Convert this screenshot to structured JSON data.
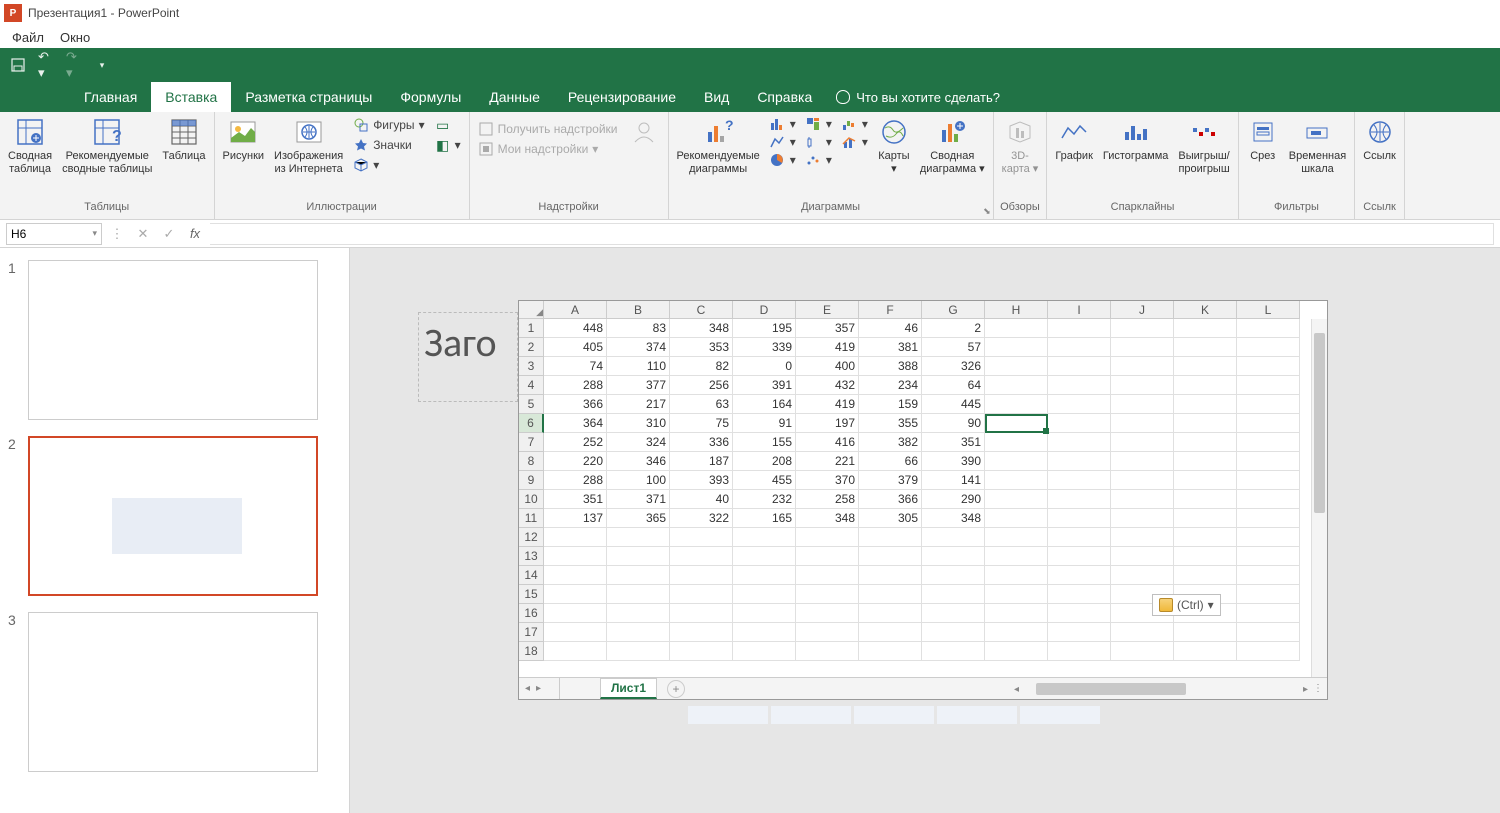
{
  "window": {
    "title": "Презентация1 - PowerPoint",
    "app_badge": "P"
  },
  "menubar": [
    "Файл",
    "Окно"
  ],
  "tabs": [
    "Главная",
    "Вставка",
    "Разметка страницы",
    "Формулы",
    "Данные",
    "Рецензирование",
    "Вид",
    "Справка"
  ],
  "active_tab": 1,
  "tell_me": "Что вы хотите сделать?",
  "ribbon_groups": {
    "tables": {
      "label": "Таблицы",
      "pivot": "Сводная\nтаблица",
      "rec_pivot": "Рекомендуемые\nсводные таблицы",
      "table": "Таблица"
    },
    "illustrations": {
      "label": "Иллюстрации",
      "pictures": "Рисунки",
      "online_pics": "Изображения\nиз Интернета",
      "shapes": "Фигуры",
      "icons": "Значки",
      "models": ""
    },
    "addins": {
      "label": "Надстройки",
      "get": "Получить надстройки",
      "my": "Мои надстройки"
    },
    "charts": {
      "label": "Диаграммы",
      "rec": "Рекомендуемые\nдиаграммы",
      "maps": "Карты",
      "pivot_chart": "Сводная\nдиаграмма"
    },
    "tours": {
      "label": "Обзоры",
      "map3d": "3D-\nкарта"
    },
    "sparklines": {
      "label": "Спарклайны",
      "line": "График",
      "column": "Гистограмма",
      "winloss": "Выигрыш/\nпроигрыш"
    },
    "filters": {
      "label": "Фильтры",
      "slicer": "Срез",
      "timeline": "Временная\nшкала"
    },
    "links": {
      "label": "Ссылк",
      "link": "Ссылк"
    }
  },
  "namebox": "H6",
  "slides": [
    1,
    2,
    3
  ],
  "selected_slide": 2,
  "title_placeholder": "Заго",
  "chart_data": {
    "type": "table",
    "columns": [
      "A",
      "B",
      "C",
      "D",
      "E",
      "F",
      "G",
      "H",
      "I",
      "J",
      "K",
      "L"
    ],
    "row_headers": [
      1,
      2,
      3,
      4,
      5,
      6,
      7,
      8,
      9,
      10,
      11,
      12,
      13,
      14,
      15,
      16,
      17,
      18
    ],
    "data": [
      [
        448,
        83,
        348,
        195,
        357,
        46,
        2
      ],
      [
        405,
        374,
        353,
        339,
        419,
        381,
        57
      ],
      [
        74,
        110,
        82,
        0,
        400,
        388,
        326
      ],
      [
        288,
        377,
        256,
        391,
        432,
        234,
        64
      ],
      [
        366,
        217,
        63,
        164,
        419,
        159,
        445
      ],
      [
        364,
        310,
        75,
        91,
        197,
        355,
        90
      ],
      [
        252,
        324,
        336,
        155,
        416,
        382,
        351
      ],
      [
        220,
        346,
        187,
        208,
        221,
        66,
        390
      ],
      [
        288,
        100,
        393,
        455,
        370,
        379,
        141
      ],
      [
        351,
        371,
        40,
        232,
        258,
        366,
        290
      ],
      [
        137,
        365,
        322,
        165,
        348,
        305,
        348
      ]
    ],
    "selected_cell": "H6",
    "sheet_name": "Лист1"
  },
  "paste_options": "(Ctrl)"
}
